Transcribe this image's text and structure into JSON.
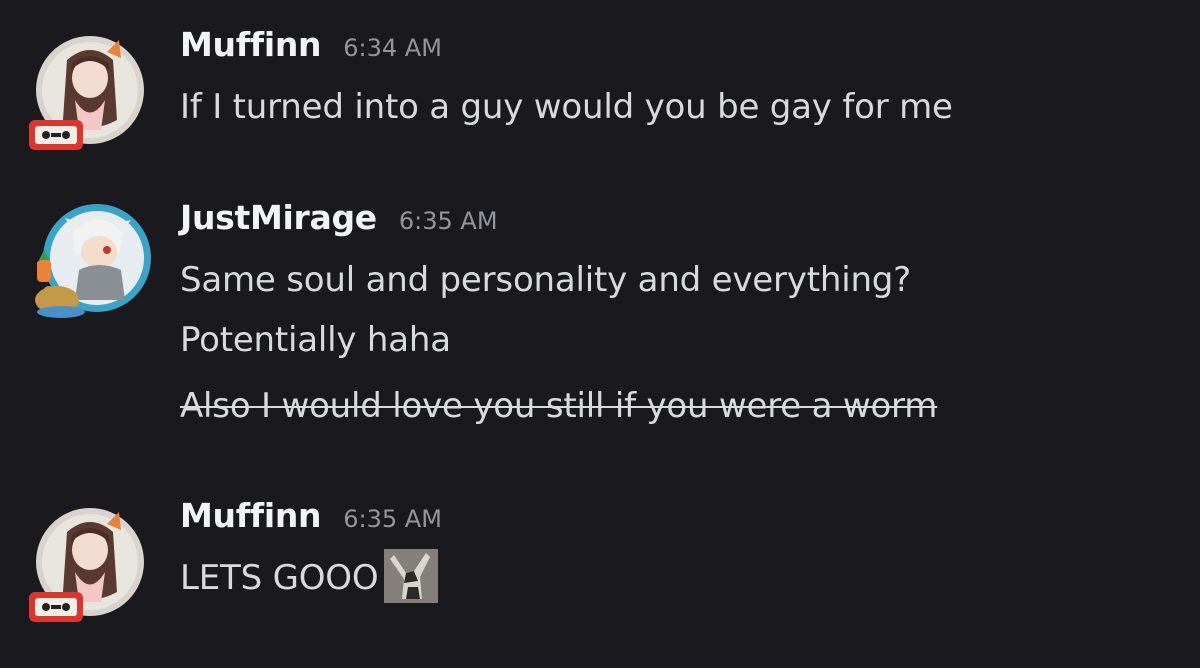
{
  "messages": [
    {
      "username": "Muffinn",
      "timestamp": "6:34 AM",
      "lines": [
        "If I turned into a guy would you be gay for me"
      ]
    },
    {
      "username": "JustMirage",
      "timestamp": "6:35 AM",
      "lines": [
        "Same soul and personality and everything?",
        "Potentially haha",
        "Also I would love you still if you were a worm"
      ]
    },
    {
      "username": "Muffinn",
      "timestamp": "6:35 AM",
      "lines": [
        "LETS GOOO"
      ]
    }
  ],
  "emoji": {
    "icon": "cat-dancing-emoji"
  },
  "colors": {
    "background": "#1a1a1e",
    "username": "#f2f3f5",
    "timestamp": "#94959c",
    "text": "#d9dadf"
  }
}
